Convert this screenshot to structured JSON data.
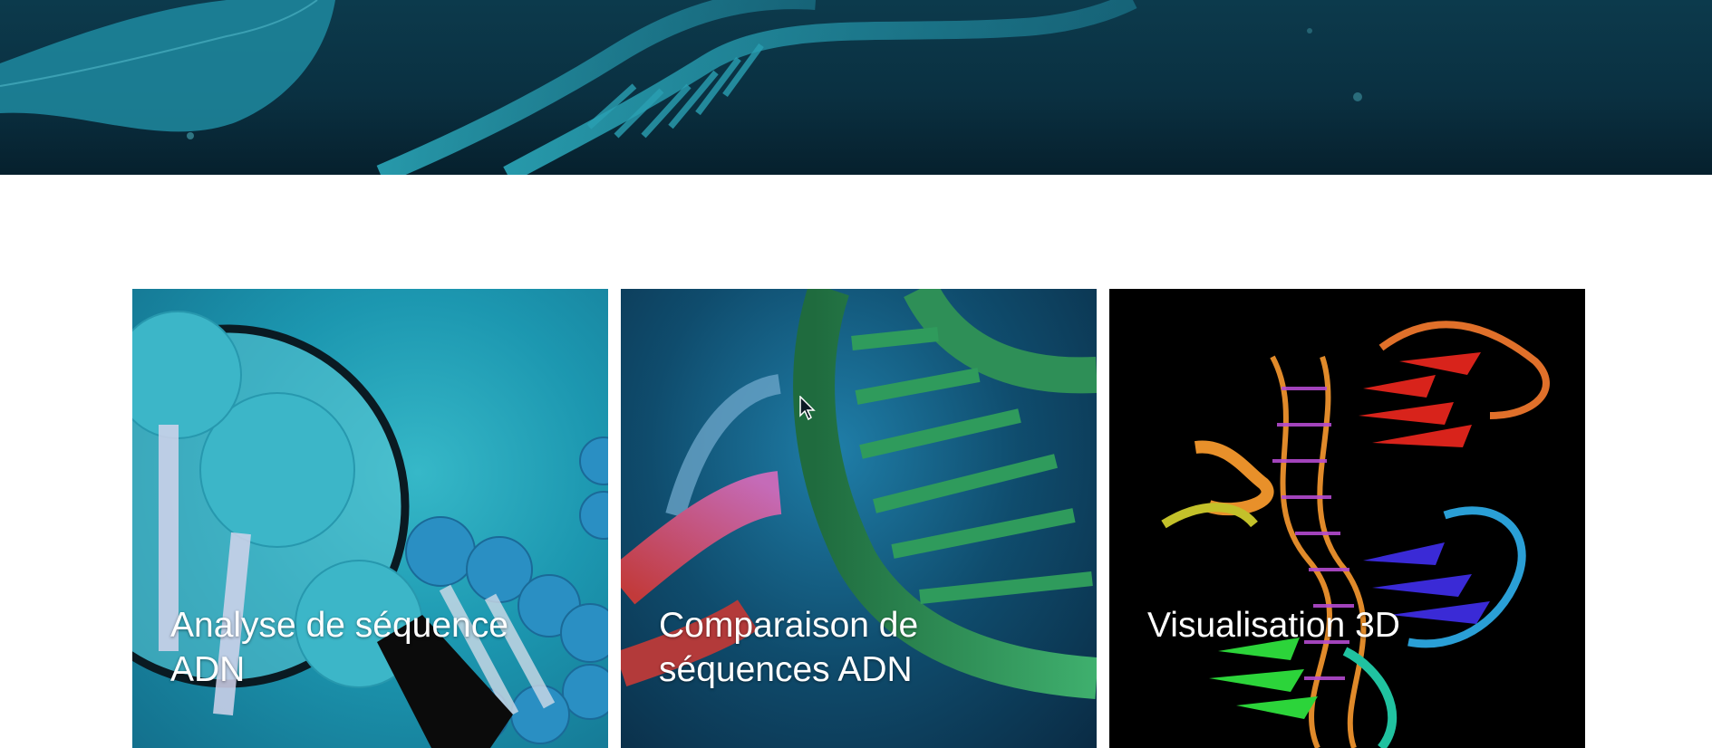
{
  "cards": [
    {
      "title": "Analyse de séquence\nADN",
      "image": "dna-magnifier-illustration"
    },
    {
      "title": "Comparaison de\nséquences ADN",
      "image": "dna-helix-illustration"
    },
    {
      "title": "Visualisation 3D",
      "image": "protein-dna-3d-structure"
    }
  ],
  "colors": {
    "hero_bg": "#0a3041",
    "card_text": "#ffffff",
    "page_bg": "#ffffff"
  }
}
